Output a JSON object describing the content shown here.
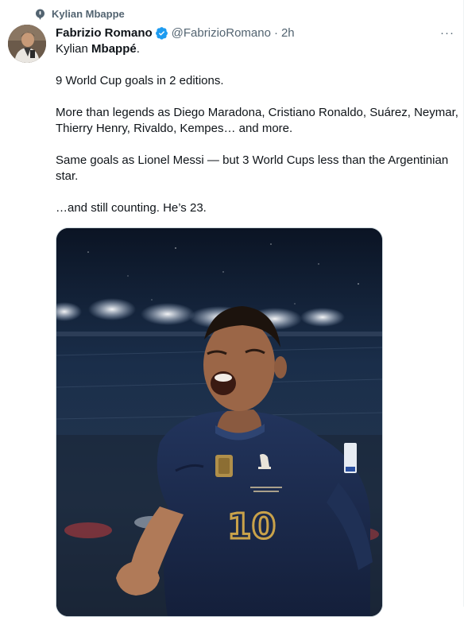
{
  "context": {
    "label": "Kylian Mbappe",
    "icon": "pin-icon"
  },
  "author": {
    "name": "Fabrizio Romano",
    "handle": "@FabrizioRomano",
    "separator": "·",
    "time": "2h",
    "verified_icon": "verified-badge-icon",
    "verified_color": "#1d9bf0"
  },
  "more_menu": {
    "label": "···"
  },
  "tweet": {
    "line1_prefix": "Kylian ",
    "line1_bold": "Mbappé",
    "line1_suffix": ".",
    "p2": "9 World Cup goals in 2 editions.",
    "p3": "More than legends as Diego Maradona, Cristiano Ronaldo, Suárez, Neymar, Thierry Henry, Rivaldo, Kempes… and more.",
    "p4": "Same goals as Lionel Messi — but 3 World Cups less than the Argentinian star.",
    "p5": "…and still counting. He’s 23."
  },
  "photo": {
    "shirt_number": "10",
    "colors": {
      "jersey": "#1b2a4d",
      "number": "#c9a24a",
      "sky": "#0e1930"
    }
  }
}
